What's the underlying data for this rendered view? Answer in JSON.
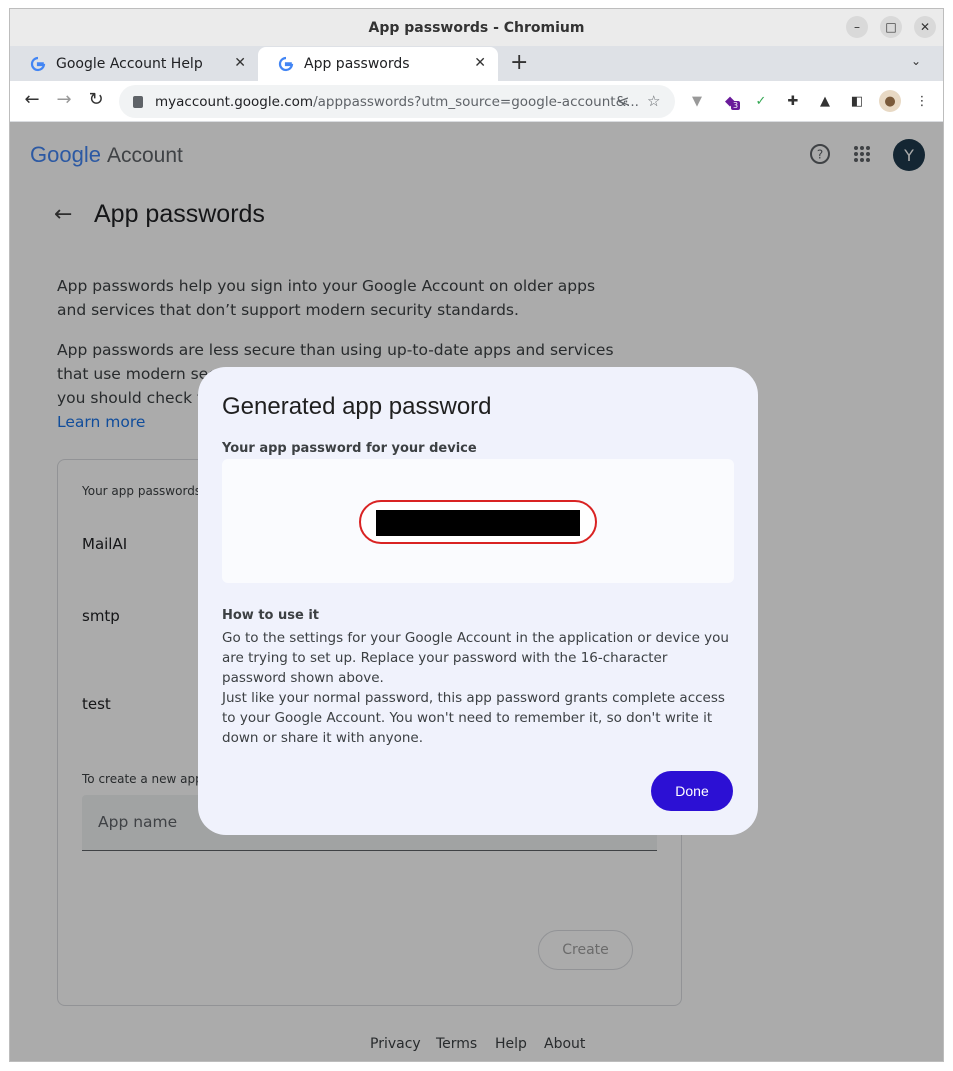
{
  "window": {
    "title": "App passwords - Chromium"
  },
  "tabs": [
    {
      "label": "Google Account Help",
      "icon": "google-g-icon"
    },
    {
      "label": "App passwords",
      "icon": "google-g-icon"
    }
  ],
  "toolbar": {
    "url_host": "myaccount.google.com",
    "url_path": "/apppasswords?utm_source=google-account&...",
    "extension_badge": "3"
  },
  "header": {
    "logo_text": "Google",
    "logo_suffix": "Account",
    "avatar_letter": "Y"
  },
  "page": {
    "title": "App passwords",
    "para1": "App passwords help you sign into your Google Account on older apps and services that don’t support modern security standards.",
    "para2_line1": "App passwords are less secure than using up-to-date apps and services",
    "para2_line2": "that use modern sec",
    "para2_line3": "you should check to",
    "learn_more": "Learn more"
  },
  "card": {
    "list_label": "Your app passwords",
    "entries": [
      "MailAI",
      "smtp",
      "test"
    ],
    "create_label": "To create a new app",
    "app_name_placeholder": "App name",
    "create_button": "Create"
  },
  "footer": {
    "privacy": "Privacy",
    "terms": "Terms",
    "help": "Help",
    "about": "About"
  },
  "dialog": {
    "title": "Generated app password",
    "subtitle": "Your app password for your device",
    "how_title": "How to use it",
    "how_p1": "Go to the settings for your Google Account in the application or device you are trying to set up. Replace your password with the 16-character password shown above.",
    "how_p2": "Just like your normal password, this app password grants complete access to your Google Account. You won't need to remember it, so don't write it down or share it with anyone.",
    "done_button": "Done"
  },
  "colors": {
    "primary_button": "#2c10d4",
    "highlight_ring": "#d92323",
    "link": "#1a73e8"
  }
}
